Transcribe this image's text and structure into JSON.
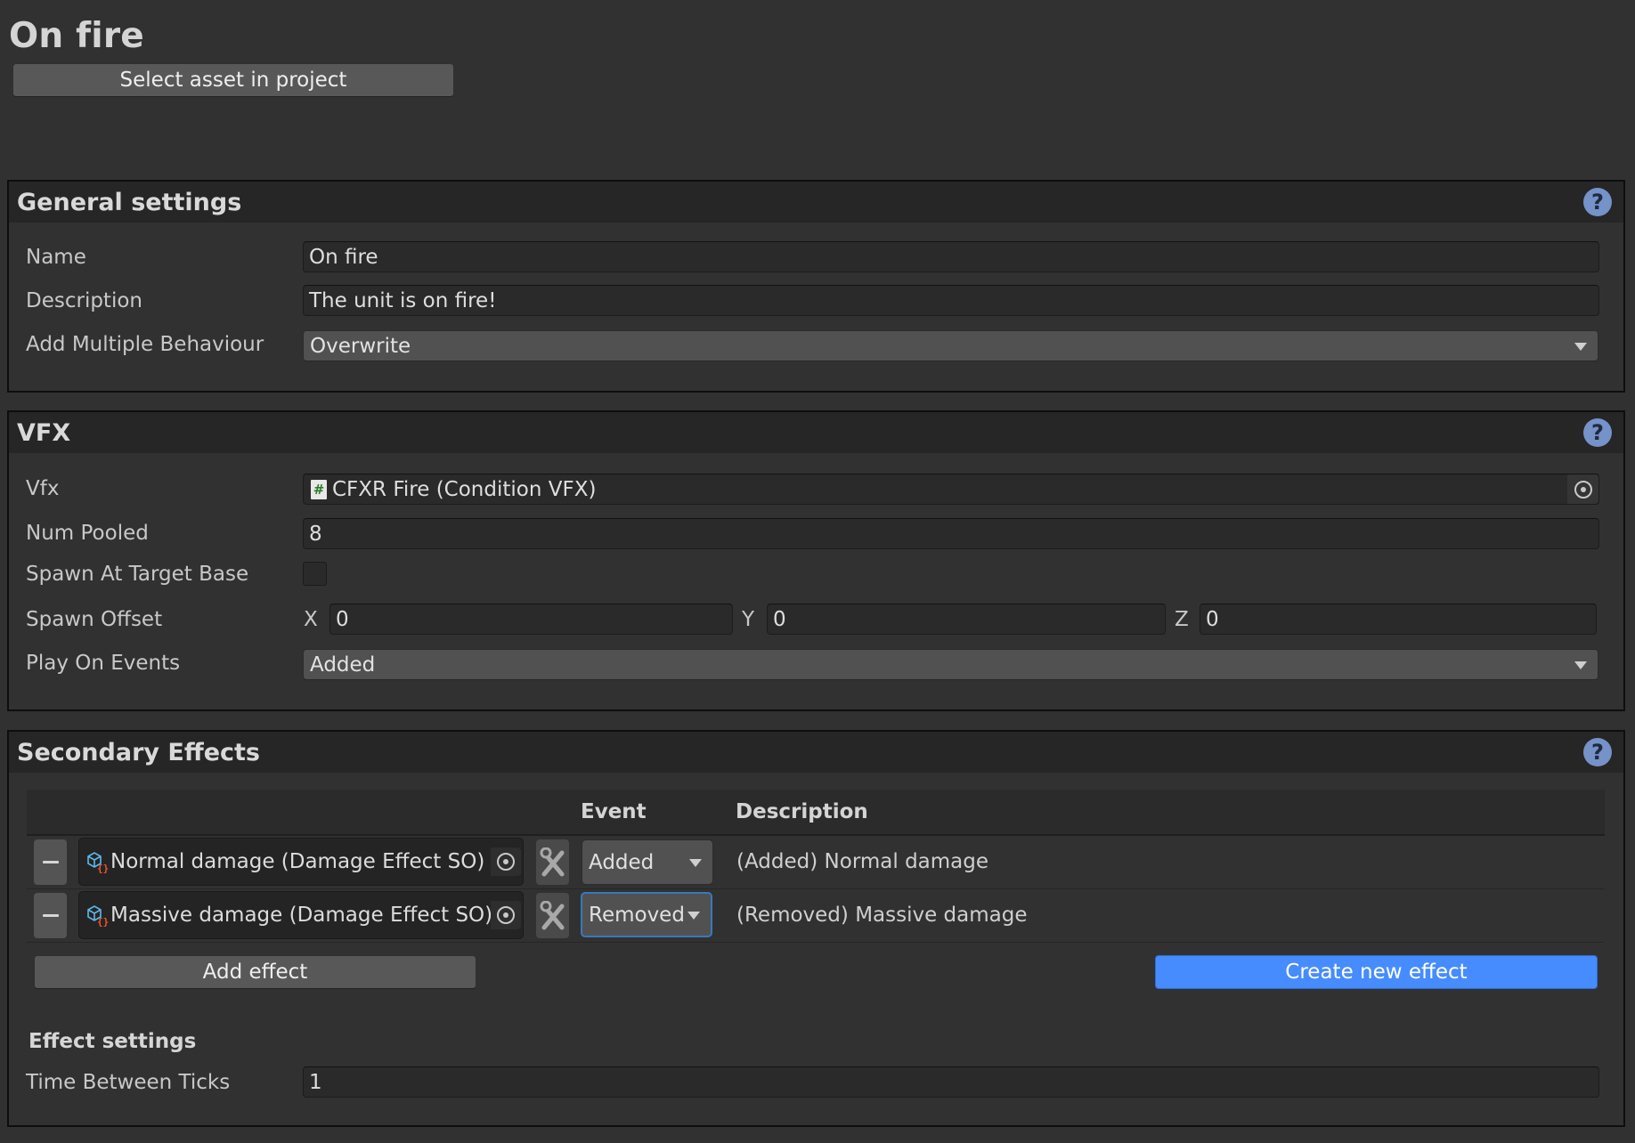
{
  "asset": {
    "title": "On fire",
    "select_button": "Select asset in project"
  },
  "general": {
    "header": "General settings",
    "help_icon": "?",
    "fields": {
      "name": {
        "label": "Name",
        "value": "On fire"
      },
      "description": {
        "label": "Description",
        "value": "The unit is on fire!"
      },
      "add_multiple": {
        "label": "Add Multiple Behaviour",
        "value": "Overwrite"
      }
    }
  },
  "vfx": {
    "header": "VFX",
    "help_icon": "?",
    "fields": {
      "vfx": {
        "label": "Vfx",
        "value": "CFXR Fire (Condition VFX)",
        "icon": "#"
      },
      "num_pooled": {
        "label": "Num Pooled",
        "value": "8"
      },
      "spawn_at_target_base": {
        "label": "Spawn At Target Base",
        "checked": false
      },
      "spawn_offset": {
        "label": "Spawn Offset",
        "x_label": "X",
        "x": "0",
        "y_label": "Y",
        "y": "0",
        "z_label": "Z",
        "z": "0"
      },
      "play_on_events": {
        "label": "Play On Events",
        "value": "Added"
      }
    }
  },
  "secondary": {
    "header": "Secondary Effects",
    "help_icon": "?",
    "columns": {
      "event": "Event",
      "description": "Description"
    },
    "rows": [
      {
        "effect": "Normal damage (Damage Effect SO)",
        "event": "Added",
        "description": "(Added) Normal damage",
        "focused": false
      },
      {
        "effect": "Massive damage (Damage Effect SO)",
        "event": "Removed",
        "description": "(Removed) Massive damage",
        "focused": true
      }
    ],
    "add_button": "Add effect",
    "create_button": "Create new effect",
    "effect_settings": {
      "header": "Effect settings",
      "time_between_ticks": {
        "label": "Time Between Ticks",
        "value": "1"
      }
    }
  },
  "colors": {
    "accent": "#468cff",
    "help_icon": "#7592c9",
    "focus_border": "#3a79bb",
    "background": "#313131"
  }
}
